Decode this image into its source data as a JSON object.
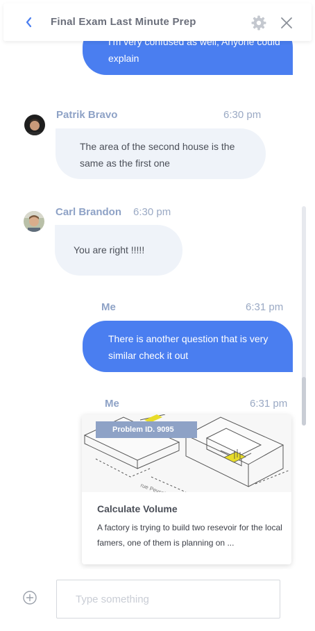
{
  "header": {
    "title": "Final Exam Last Minute Prep"
  },
  "colors": {
    "accent": "#4a7ef0",
    "incoming_bubble": "#eff3f9",
    "sender": "#8ea2c6",
    "badge": "#8ea2c6"
  },
  "messages": [
    {
      "sender": "",
      "time": "",
      "text": "I'm very confused as well, Anyone could explain",
      "direction": "outgoing"
    },
    {
      "sender": "Patrik Bravo",
      "time": "6:30 pm",
      "text": "The area of the second house is the same as the first one",
      "direction": "incoming"
    },
    {
      "sender": "Carl Brandon",
      "time": "6:30 pm",
      "text": "You are right !!!!!",
      "direction": "incoming"
    },
    {
      "sender": "Me",
      "time": "6:31 pm",
      "text": "There is another question that is very similar check it out",
      "direction": "outgoing"
    },
    {
      "sender": "Me",
      "time": "6:31 pm",
      "direction": "outgoing"
    }
  ],
  "card": {
    "badge": "Problem ID. 9095",
    "title": "Calculate Volume",
    "description": "A factory is trying to build two resevoir for the local famers, one of them is planning on ..."
  },
  "composer": {
    "placeholder": "Type something"
  }
}
